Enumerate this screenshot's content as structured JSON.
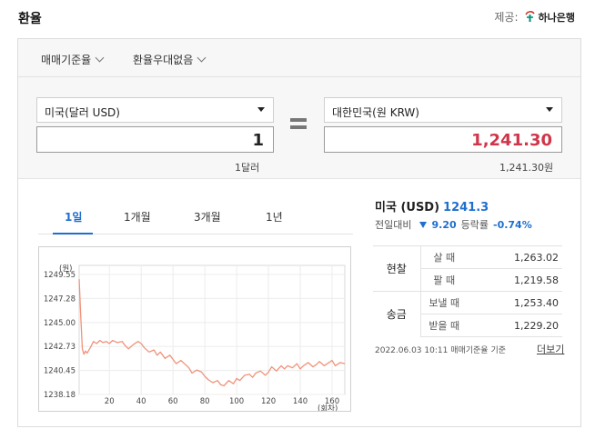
{
  "header": {
    "title": "환율",
    "provider_label": "제공:",
    "provider_name": "하나은행"
  },
  "filters": [
    {
      "label": "매매기준율"
    },
    {
      "label": "환율우대없음"
    }
  ],
  "converter": {
    "from_currency": "미국(달러 USD)",
    "from_amount": "1",
    "from_sub": "1달러",
    "to_currency": "대한민국(원 KRW)",
    "to_amount": "1,241.30",
    "to_sub": "1,241.30원"
  },
  "tabs": [
    {
      "label": "1일",
      "active": true
    },
    {
      "label": "1개월"
    },
    {
      "label": "3개월"
    },
    {
      "label": "1년"
    }
  ],
  "info": {
    "country": "미국 (USD)",
    "rate": "1241.3",
    "change_label": "전일대비",
    "change_value": "9.20",
    "ratio_label": "등락률",
    "ratio_value": "-0.74%"
  },
  "rate_table": {
    "groups": [
      {
        "name": "현찰",
        "rows": [
          {
            "label": "살 때",
            "value": "1,263.02"
          },
          {
            "label": "팔 때",
            "value": "1,219.58"
          }
        ]
      },
      {
        "name": "송금",
        "rows": [
          {
            "label": "보낼 때",
            "value": "1,253.40"
          },
          {
            "label": "받을 때",
            "value": "1,229.20"
          }
        ]
      }
    ]
  },
  "footnote": "2022.06.03 10:11 매매기준율 기준",
  "more_link": "더보기",
  "colors": {
    "accent": "#1f6fce",
    "down": "#1f6fce",
    "result": "#d0354a",
    "line": "#f0937a"
  },
  "chart_data": {
    "type": "line",
    "title": "",
    "xlabel": "(회차)",
    "ylabel": "(원)",
    "x_ticks": [
      20,
      40,
      60,
      80,
      100,
      120,
      140,
      160
    ],
    "y_ticks": [
      "1249.55",
      "1247.28",
      "1245.00",
      "1242.73",
      "1240.45",
      "1238.18"
    ],
    "xlim": [
      1,
      168
    ],
    "ylim": [
      1238.18,
      1249.55
    ],
    "grid": true,
    "series": [
      {
        "x": [
          1,
          2,
          3,
          4,
          5,
          6,
          8,
          10,
          12,
          14,
          16,
          18,
          20,
          22,
          25,
          28,
          30,
          32,
          35,
          38,
          40,
          42,
          45,
          48,
          50,
          52,
          55,
          58,
          60,
          62,
          65,
          68,
          70,
          72,
          75,
          78,
          80,
          82,
          85,
          88,
          90,
          92,
          95,
          98,
          100,
          102,
          105,
          108,
          110,
          112,
          115,
          118,
          120,
          122,
          125,
          128,
          130,
          132,
          135,
          138,
          140,
          142,
          145,
          148,
          150,
          152,
          155,
          158,
          160,
          162,
          165,
          168
        ],
        "y": [
          1249.1,
          1245.7,
          1242.5,
          1242.0,
          1242.3,
          1242.1,
          1242.6,
          1243.2,
          1243.0,
          1243.3,
          1243.1,
          1243.2,
          1243.0,
          1243.3,
          1243.1,
          1243.2,
          1242.8,
          1242.5,
          1242.9,
          1243.2,
          1243.0,
          1242.6,
          1242.2,
          1242.4,
          1241.9,
          1242.2,
          1241.6,
          1241.9,
          1241.5,
          1241.1,
          1241.4,
          1241.0,
          1240.7,
          1240.2,
          1240.5,
          1240.3,
          1239.9,
          1239.6,
          1239.3,
          1239.5,
          1239.1,
          1239.0,
          1239.5,
          1239.2,
          1239.7,
          1239.5,
          1240.0,
          1240.1,
          1239.8,
          1240.2,
          1240.4,
          1240.0,
          1240.3,
          1240.8,
          1240.4,
          1240.9,
          1240.6,
          1240.9,
          1240.7,
          1241.1,
          1240.6,
          1240.9,
          1241.2,
          1240.8,
          1241.0,
          1241.3,
          1240.9,
          1241.2,
          1241.4,
          1240.9,
          1241.2,
          1241.1
        ]
      }
    ]
  }
}
